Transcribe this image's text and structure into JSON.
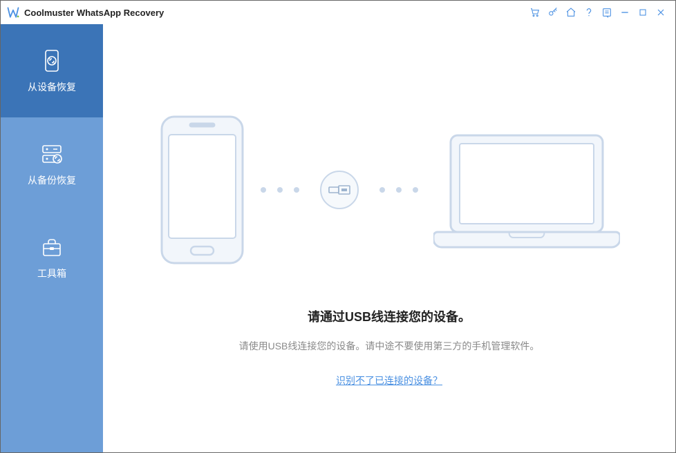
{
  "titlebar": {
    "app_name": "Coolmuster WhatsApp Recovery"
  },
  "sidebar": {
    "items": [
      {
        "label": "从设备恢复",
        "icon": "phone-recover-icon",
        "active": true
      },
      {
        "label": "从备份恢复",
        "icon": "backup-recover-icon",
        "active": false
      },
      {
        "label": "工具箱",
        "icon": "toolbox-icon",
        "active": false
      }
    ]
  },
  "main": {
    "headline": "请通过USB线连接您的设备。",
    "subtext": "请使用USB线连接您的设备。请中途不要使用第三方的手机管理软件。",
    "help_link": "识别不了已连接的设备？"
  },
  "icons": {
    "cart": "cart-icon",
    "key": "key-icon",
    "home": "home-icon",
    "help": "help-icon",
    "feedback": "feedback-icon",
    "minimize": "minimize-icon",
    "maximize": "maximize-icon",
    "close": "close-icon"
  }
}
